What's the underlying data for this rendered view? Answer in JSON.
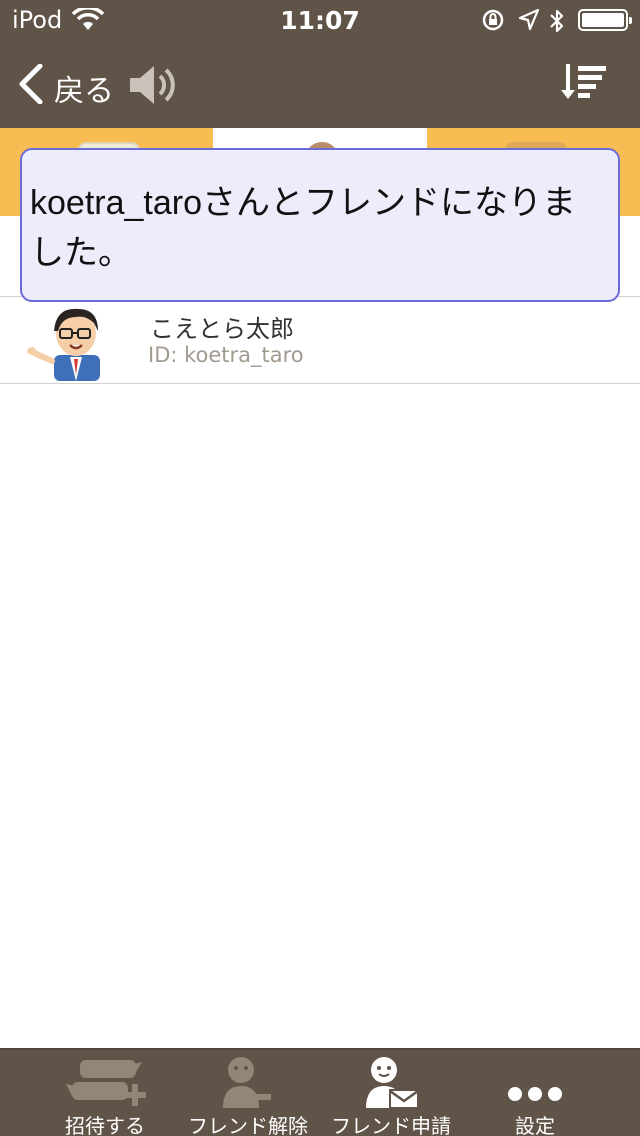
{
  "status_bar": {
    "carrier": "iPod",
    "time": "11:07",
    "icons": [
      "wifi-icon",
      "orientation-lock-icon",
      "location-icon",
      "bluetooth-icon",
      "battery-icon"
    ]
  },
  "nav": {
    "back_label": "戻る",
    "icons": [
      "back-chevron-icon",
      "speaker-icon",
      "sort-icon"
    ]
  },
  "tabs": [
    {
      "icon": "chat-icon",
      "active": false
    },
    {
      "icon": "friends-icon",
      "active": true
    },
    {
      "icon": "folder-icon",
      "active": false
    }
  ],
  "toast": {
    "message": "koetra_taroさんとフレンドになりました。"
  },
  "friends": [
    {
      "name": "こえとら太郎",
      "id_text": "ID: koetra_taro",
      "avatar_icon": "avatar-man-glasses"
    }
  ],
  "toolbar": [
    {
      "label": "招待する",
      "icon": "invite-icon",
      "enabled": false
    },
    {
      "label": "フレンド解除",
      "icon": "remove-friend-icon",
      "enabled": false
    },
    {
      "label": "フレンド申請",
      "icon": "friend-request-icon",
      "enabled": true
    },
    {
      "label": "設定",
      "icon": "more-icon",
      "enabled": true
    }
  ],
  "colors": {
    "bar_brown": "#605347",
    "tab_orange": "#f7bd52",
    "toast_bg": "#ececfa",
    "toast_border": "#6a6bd8",
    "id_gray": "#a29a8f"
  }
}
